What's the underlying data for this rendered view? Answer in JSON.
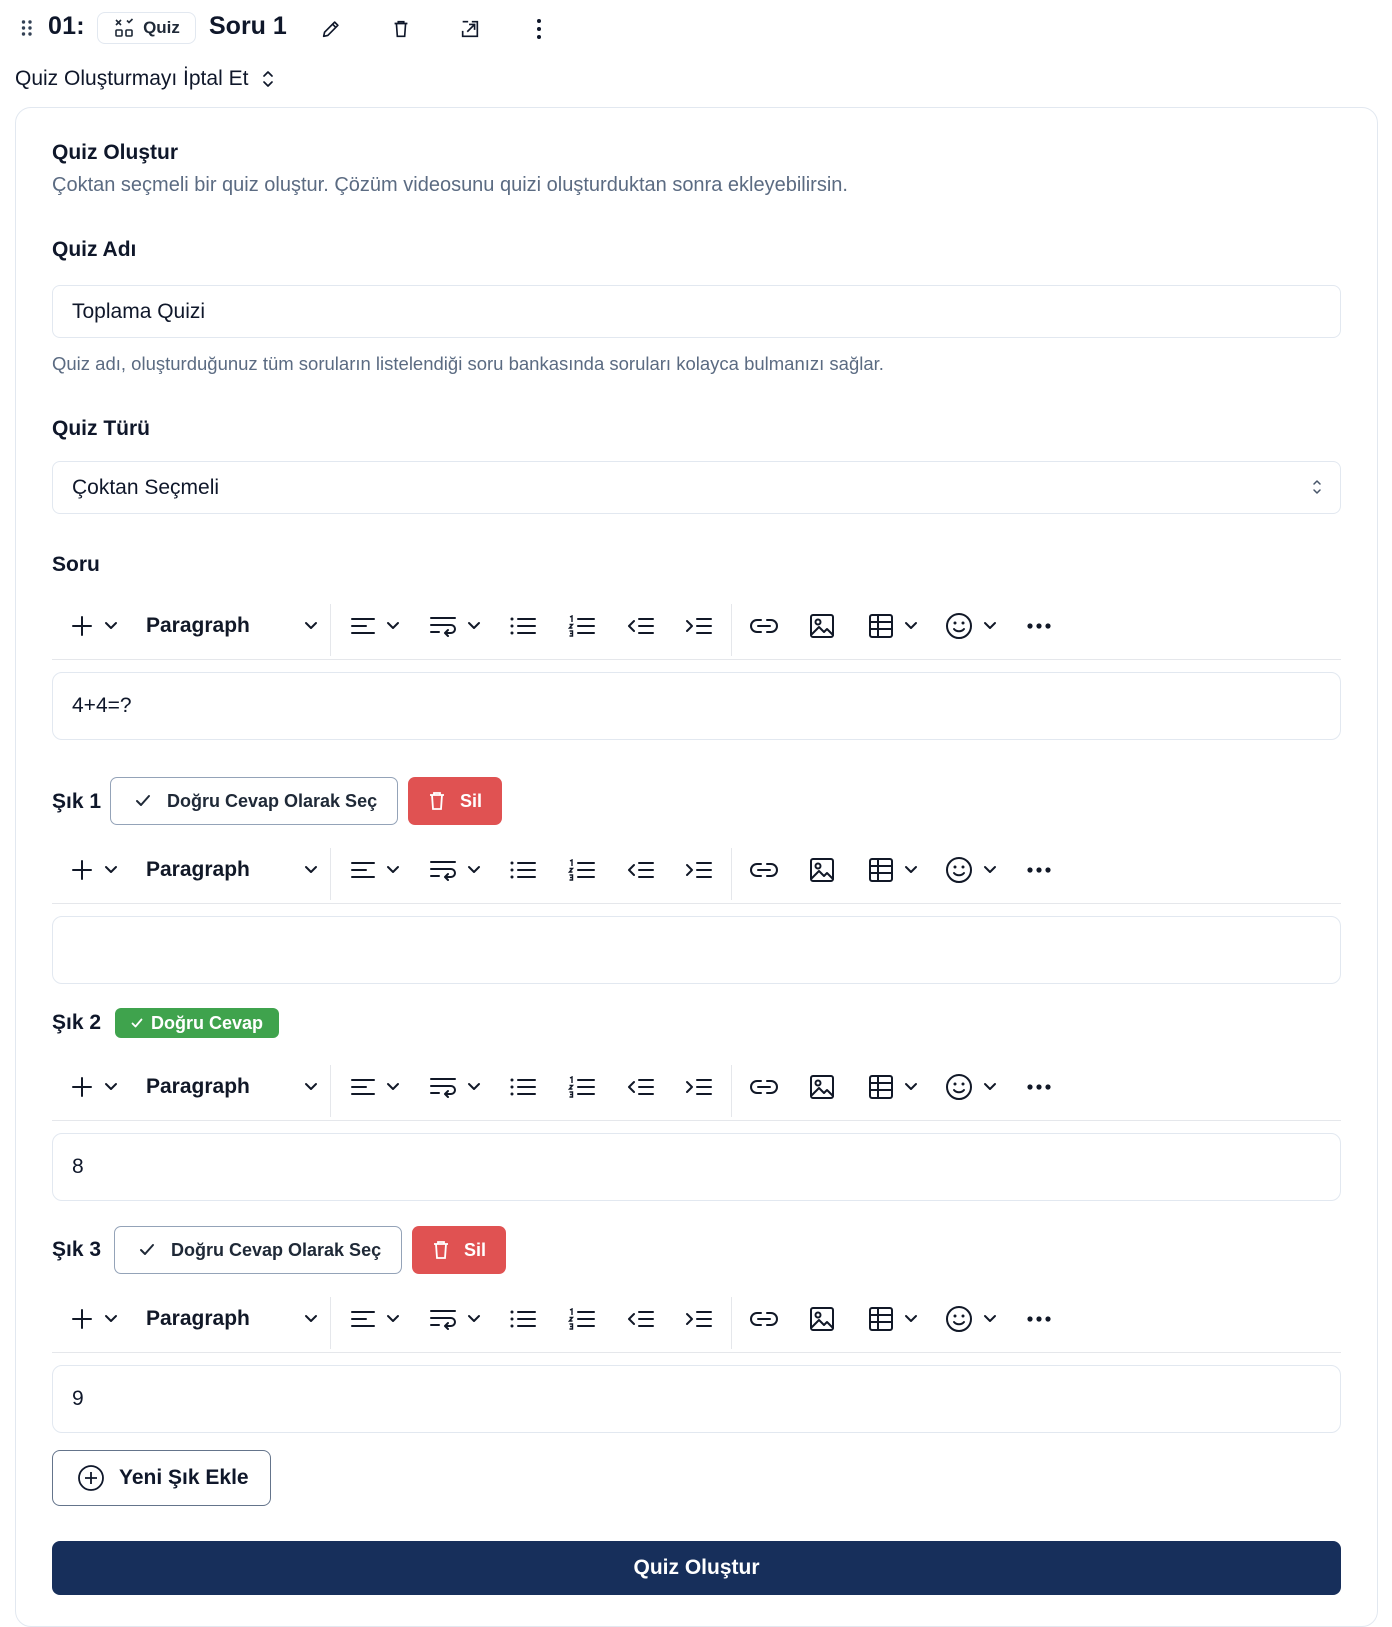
{
  "header": {
    "number": "01:",
    "badge_label": "Quiz",
    "title": "Soru 1",
    "icons": [
      "drag-handle-icon",
      "quiz-icon",
      "pencil-icon",
      "trash-icon",
      "open-external-icon",
      "more-vertical-icon"
    ]
  },
  "cancel": {
    "label": "Quiz Oluşturmayı İptal Et"
  },
  "card": {
    "title": "Quiz Oluştur",
    "subtitle": "Çoktan seçmeli bir quiz oluştur. Çözüm videosunu quizi oluşturduktan sonra ekleyebilirsin."
  },
  "quiz_name": {
    "label": "Quiz Adı",
    "value": "Toplama Quizi",
    "help": "Quiz adı, oluşturduğunuz tüm soruların listelendiği soru bankasında soruları kolayca bulmanızı sağlar."
  },
  "quiz_type": {
    "label": "Quiz Türü",
    "selected": "Çoktan Seçmeli"
  },
  "question": {
    "label": "Soru",
    "content": "4+4=?"
  },
  "toolbar": {
    "paragraph_label": "Paragraph",
    "icons": [
      "plus-icon",
      "align-icon",
      "wrap-icon",
      "bullet-list-icon",
      "numbered-list-icon",
      "outdent-icon",
      "indent-icon",
      "link-icon",
      "image-icon",
      "table-icon",
      "emoji-icon",
      "more-horizontal-icon"
    ]
  },
  "options": [
    {
      "label": "Şık 1",
      "content": "",
      "is_correct": false,
      "select_label": "Doğru Cevap Olarak Seç",
      "delete_label": "Sil"
    },
    {
      "label": "Şık 2",
      "content": "8",
      "is_correct": true,
      "correct_label": "Doğru Cevap"
    },
    {
      "label": "Şık 3",
      "content": "9",
      "is_correct": false,
      "select_label": "Doğru Cevap Olarak Seç",
      "delete_label": "Sil"
    }
  ],
  "add_option": {
    "label": "Yeni Şık Ekle"
  },
  "submit": {
    "label": "Quiz Oluştur"
  },
  "colors": {
    "primary": "#172f5b",
    "danger": "#e05252",
    "success": "#3fa34d",
    "muted_text": "#5b6b82",
    "border": "#e2e8f0"
  }
}
